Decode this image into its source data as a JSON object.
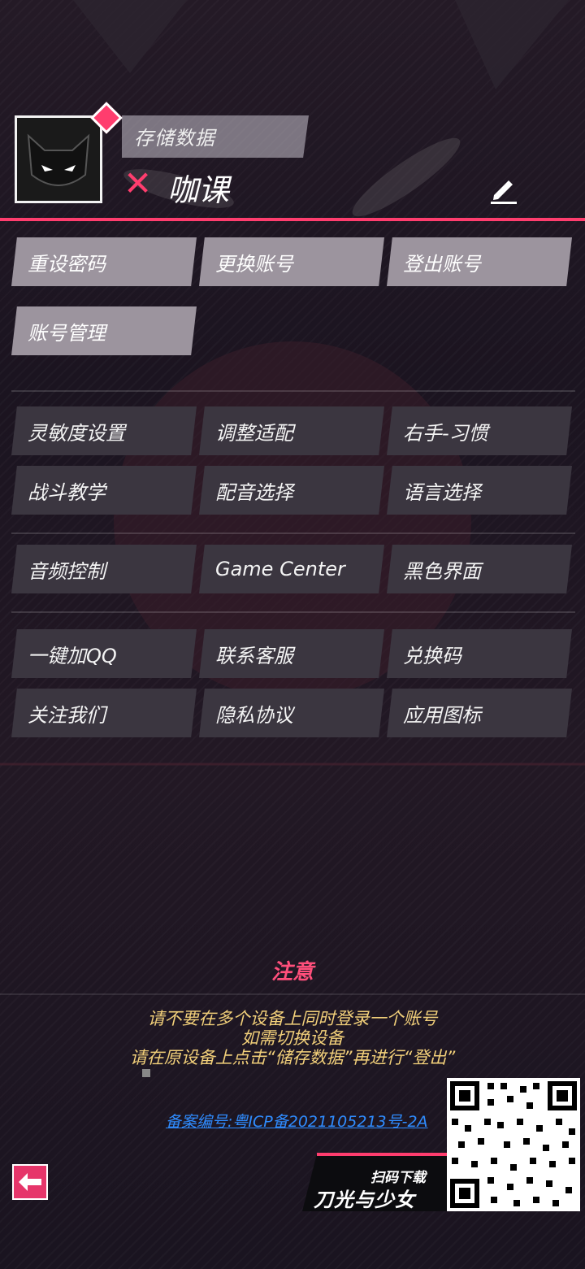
{
  "profile": {
    "save_label": "存储数据",
    "username": "咖课"
  },
  "account_buttons": [
    "重设密码",
    "更换账号",
    "登出账号",
    "账号管理"
  ],
  "settings_buttons": [
    "灵敏度设置",
    "调整适配",
    "右手-习惯",
    "战斗教学",
    "配音选择",
    "语言选择"
  ],
  "system_buttons": [
    "音频控制",
    "Game Center",
    "黑色界面"
  ],
  "service_buttons": [
    "一键加QQ",
    "联系客服",
    "兑换码",
    "关注我们",
    "隐私协议",
    "应用图标"
  ],
  "notice": {
    "title": "注意",
    "lines": [
      "请不要在多个设备上同时登录一个账号",
      "如需切换设备",
      "请在原设备上点击“储存数据”再进行“登出”"
    ]
  },
  "icp": "备案编号:粤ICP备2021105213号-2A",
  "promo": {
    "small": "扫码下载",
    "big": "刀光与少女"
  },
  "colors": {
    "accent": "#ff3d6e",
    "notice_text": "#f2d07a",
    "link": "#2f8cff",
    "button": "#3b3640"
  }
}
